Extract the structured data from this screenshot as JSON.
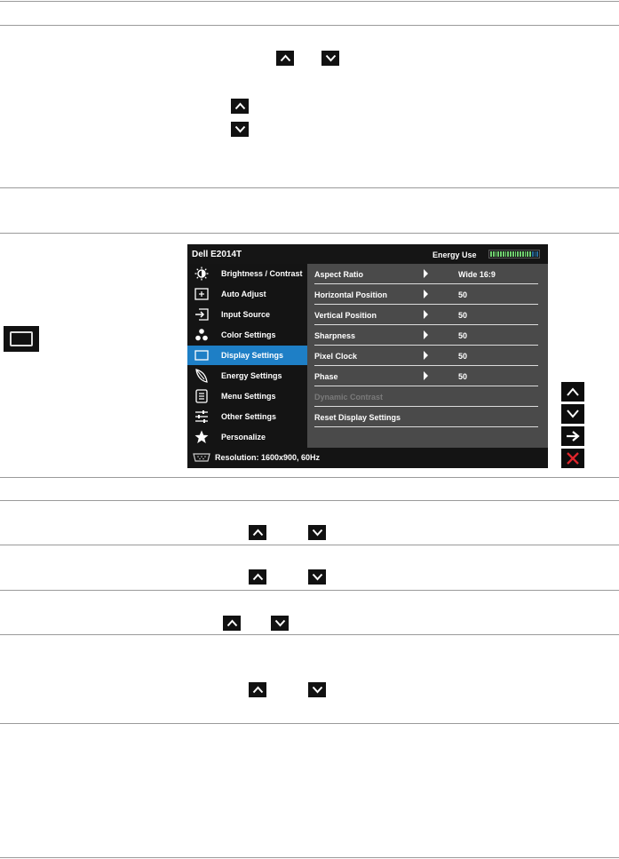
{
  "osd": {
    "model": "Dell E2014T",
    "energy_label": "Energy Use",
    "energy_meter": {
      "lit_fraction": 0.85,
      "lit_color": "#6fd06f",
      "dim_color": "#246a9c"
    },
    "accent_color": "#1e7fc6",
    "menu": [
      {
        "label": "Brightness / Contrast",
        "icon": "brightness-icon"
      },
      {
        "label": "Auto Adjust",
        "icon": "auto-adjust-icon"
      },
      {
        "label": "Input Source",
        "icon": "input-source-icon"
      },
      {
        "label": "Color Settings",
        "icon": "color-settings-icon"
      },
      {
        "label": "Display Settings",
        "icon": "display-settings-icon",
        "active": true
      },
      {
        "label": "Energy Settings",
        "icon": "energy-leaf-icon"
      },
      {
        "label": "Menu Settings",
        "icon": "menu-settings-icon"
      },
      {
        "label": "Other Settings",
        "icon": "other-settings-icon"
      },
      {
        "label": "Personalize",
        "icon": "star-icon"
      }
    ],
    "settings": [
      {
        "label": "Aspect Ratio",
        "value": "Wide 16:9"
      },
      {
        "label": "Horizontal Position",
        "value": "50"
      },
      {
        "label": "Vertical Position",
        "value": "50"
      },
      {
        "label": "Sharpness",
        "value": "50"
      },
      {
        "label": "Pixel Clock",
        "value": "50"
      },
      {
        "label": "Phase",
        "value": "50"
      },
      {
        "label": "Dynamic Contrast",
        "value": "",
        "disabled": true
      },
      {
        "label": "Reset Display Settings",
        "value": ""
      }
    ],
    "status": "Resolution: 1600x900, 60Hz"
  },
  "side_buttons": [
    "up-icon",
    "down-icon",
    "right-arrow-icon",
    "close-icon"
  ]
}
